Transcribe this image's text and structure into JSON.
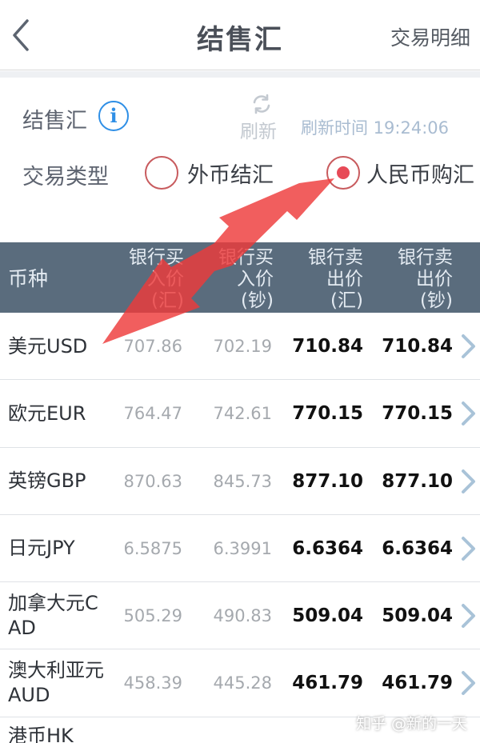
{
  "nav": {
    "title": "结售汇",
    "right_link": "交易明细",
    "back_icon": "chevron-left-icon"
  },
  "info": {
    "fx_label": "结售汇",
    "info_icon_glyph": "i",
    "refresh_label": "刷新",
    "refresh_time": "刷新时间 19:24:06",
    "type_label": "交易类型",
    "options": [
      {
        "label": "外币结汇",
        "selected": false
      },
      {
        "label": "人民币购汇",
        "selected": true
      }
    ]
  },
  "table": {
    "headers": {
      "currency": "币种",
      "buy_fx": [
        "银行买",
        "入价",
        "(汇)"
      ],
      "buy_cash": [
        "银行买",
        "入价",
        "(钞)"
      ],
      "sell_fx": [
        "银行卖",
        "出价",
        "(汇)"
      ],
      "sell_cash": [
        "银行卖",
        "出价",
        "(钞)"
      ]
    },
    "rows": [
      {
        "currency": "美元USD",
        "buy_fx": "707.86",
        "buy_cash": "702.19",
        "sell_fx": "710.84",
        "sell_cash": "710.84"
      },
      {
        "currency": "欧元EUR",
        "buy_fx": "764.47",
        "buy_cash": "742.61",
        "sell_fx": "770.15",
        "sell_cash": "770.15"
      },
      {
        "currency": "英镑GBP",
        "buy_fx": "870.63",
        "buy_cash": "845.73",
        "sell_fx": "877.10",
        "sell_cash": "877.10"
      },
      {
        "currency": "日元JPY",
        "buy_fx": "6.5875",
        "buy_cash": "6.3991",
        "sell_fx": "6.6364",
        "sell_cash": "6.6364"
      },
      {
        "currency": "加拿大元CAD",
        "buy_fx": "505.29",
        "buy_cash": "490.83",
        "sell_fx": "509.04",
        "sell_cash": "509.04"
      },
      {
        "currency": "澳大利亚元AUD",
        "buy_fx": "458.39",
        "buy_cash": "445.28",
        "sell_fx": "461.79",
        "sell_cash": "461.79"
      }
    ],
    "partial_row": {
      "currency": "港币HK"
    }
  },
  "watermark": "知乎 @新的一天",
  "colors": {
    "header_bg": "#5a6c7d",
    "radio_accent": "#e74a57",
    "info_blue": "#2f8fe6",
    "annotation_arrow": "#ee3a3a"
  }
}
